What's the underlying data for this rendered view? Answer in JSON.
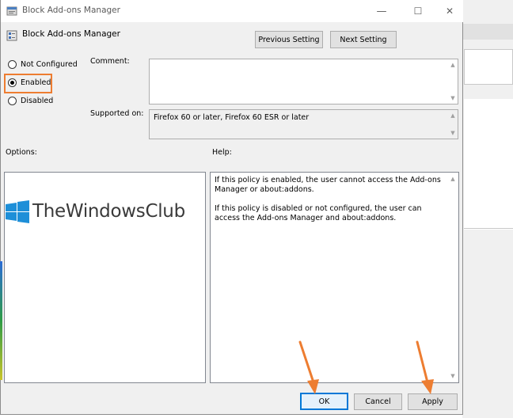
{
  "window": {
    "title": "Block Add-ons Manager",
    "minimize_glyph": "—",
    "maximize_glyph": "☐",
    "close_glyph": "✕"
  },
  "header": {
    "policy_title": "Block Add-ons Manager",
    "previous_label": "Previous Setting",
    "next_label": "Next Setting"
  },
  "state": {
    "options": [
      {
        "label": "Not Configured",
        "checked": false
      },
      {
        "label": "Enabled",
        "checked": true
      },
      {
        "label": "Disabled",
        "checked": false
      }
    ]
  },
  "comment": {
    "label": "Comment:",
    "value": ""
  },
  "supported": {
    "label": "Supported on:",
    "value": "Firefox 60 or later, Firefox 60 ESR or later"
  },
  "options_pane": {
    "label": "Options:"
  },
  "help_pane": {
    "label": "Help:",
    "paragraphs": [
      "If this policy is enabled, the user cannot access the Add-ons Manager or about:addons.",
      "If this policy is disabled or not configured, the user can access the Add-ons Manager and about:addons."
    ]
  },
  "footer": {
    "ok_label": "OK",
    "cancel_label": "Cancel",
    "apply_label": "Apply"
  },
  "watermark": {
    "text": "TheWindowsClub"
  },
  "colors": {
    "annotation_orange": "#ed7d31",
    "focus_blue": "#0078d7",
    "watermark_blue": "#1e8fd8",
    "dialog_bg": "#f0f0f0"
  },
  "icons": [
    "app-icon",
    "policy-icon",
    "windows-logo-icon",
    "arrow-down-icon"
  ]
}
